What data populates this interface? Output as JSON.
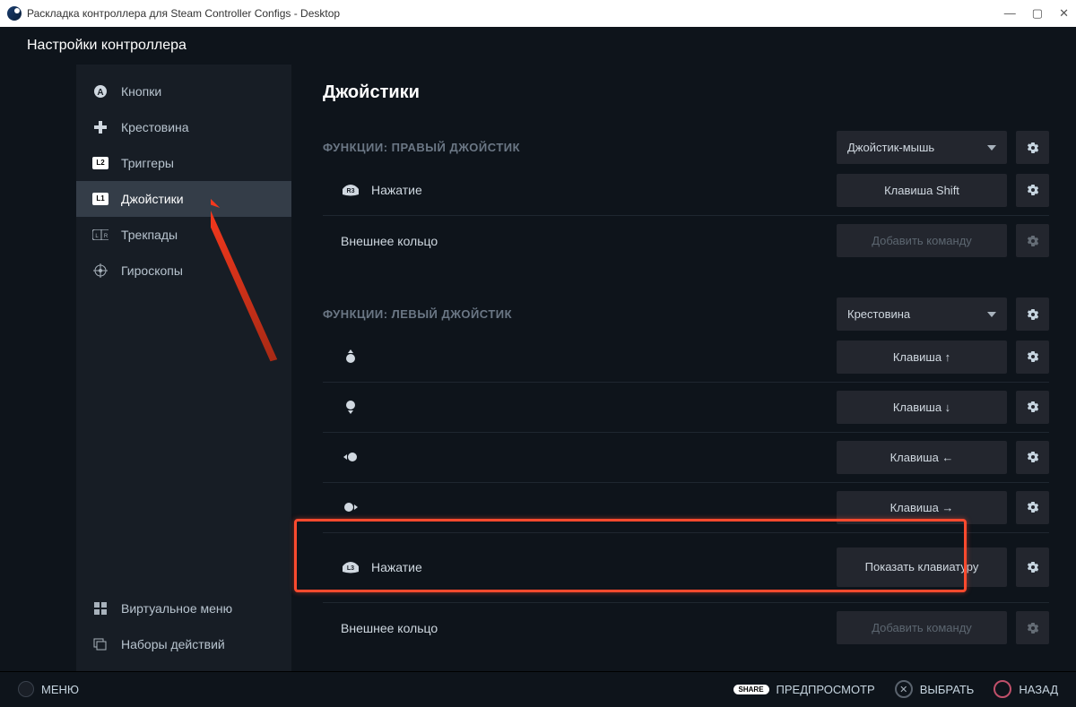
{
  "titlebar": {
    "title": "Раскладка контроллера для Steam Controller Configs - Desktop"
  },
  "header": {
    "title": "Настройки контроллера"
  },
  "sidebar": {
    "items": [
      {
        "label": "Кнопки",
        "icon": "circle-a"
      },
      {
        "label": "Крестовина",
        "icon": "plus"
      },
      {
        "label": "Триггеры",
        "icon": "l2"
      },
      {
        "label": "Джойстики",
        "icon": "l1",
        "active": true
      },
      {
        "label": "Трекпады",
        "icon": "trackpad"
      },
      {
        "label": "Гироскопы",
        "icon": "gyro"
      }
    ],
    "bottom": [
      {
        "label": "Виртуальное меню",
        "icon": "grid"
      },
      {
        "label": "Наборы действий",
        "icon": "layers"
      }
    ]
  },
  "page": {
    "title": "Джойстики"
  },
  "sections": {
    "right": {
      "label": "ФУНКЦИИ: ПРАВЫЙ ДЖОЙСТИК",
      "mode": "Джойстик-мышь",
      "rows": [
        {
          "icon": "r3",
          "label": "Нажатие",
          "value": "Клавиша Shift"
        },
        {
          "icon": "",
          "label": "Внешнее кольцо",
          "value": "Добавить команду",
          "placeholder": true
        }
      ]
    },
    "left": {
      "label": "ФУНКЦИИ: ЛЕВЫЙ ДЖОЙСТИК",
      "mode": "Крестовина",
      "rows": [
        {
          "icon": "stick-up",
          "label": "",
          "value": "Клавиша ↑"
        },
        {
          "icon": "stick-down",
          "label": "",
          "value": "Клавиша ↓"
        },
        {
          "icon": "stick-left",
          "label": "",
          "value": "Клавиша ←"
        },
        {
          "icon": "stick-right",
          "label": "",
          "value": "Клавиша →"
        },
        {
          "icon": "l3",
          "label": "Нажатие",
          "value": "Показать клавиатуру",
          "highlight": true
        },
        {
          "icon": "",
          "label": "Внешнее кольцо",
          "value": "Добавить команду",
          "placeholder": true
        }
      ]
    }
  },
  "footer": {
    "menu": "МЕНЮ",
    "preview": "ПРЕДПРОСМОТР",
    "select": "ВЫБРАТЬ",
    "back": "НАЗАД",
    "share": "SHARE"
  }
}
